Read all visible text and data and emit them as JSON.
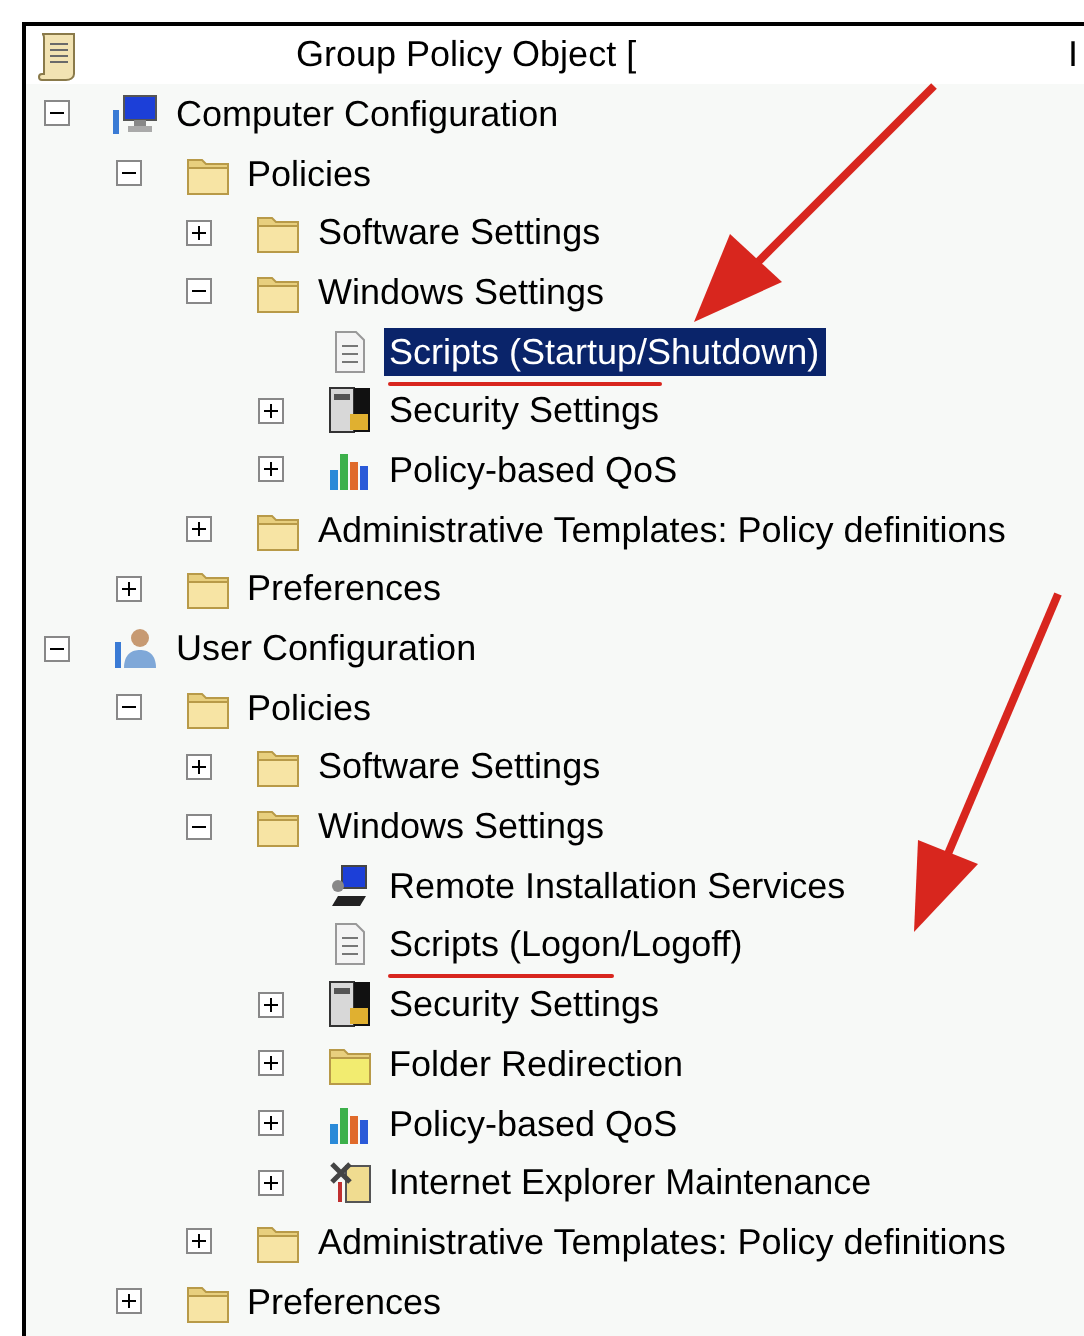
{
  "header": {
    "title": "Group Policy Object [",
    "column_2": "I"
  },
  "tree": [
    {
      "label": "Computer Configuration",
      "kind": "computer",
      "expanded": true,
      "selected": false,
      "children": [
        {
          "label": "Policies",
          "kind": "folder",
          "expanded": true,
          "selected": false,
          "children": [
            {
              "label": "Software Settings",
              "kind": "folder",
              "expanded": false,
              "selected": false
            },
            {
              "label": "Windows Settings",
              "kind": "folder",
              "expanded": true,
              "selected": false,
              "children": [
                {
                  "label": "Scripts (Startup/Shutdown)",
                  "kind": "script",
                  "selected": true,
                  "underlined": true
                },
                {
                  "label": "Security Settings",
                  "kind": "security",
                  "expanded": false,
                  "selected": false
                },
                {
                  "label": "Policy-based QoS",
                  "kind": "qos",
                  "expanded": false,
                  "selected": false
                }
              ]
            },
            {
              "label": "Administrative Templates: Policy definitions",
              "kind": "folder",
              "expanded": false,
              "selected": false
            }
          ]
        },
        {
          "label": "Preferences",
          "kind": "folder",
          "expanded": false,
          "selected": false
        }
      ]
    },
    {
      "label": "User Configuration",
      "kind": "user",
      "expanded": true,
      "selected": false,
      "children": [
        {
          "label": "Policies",
          "kind": "folder",
          "expanded": true,
          "selected": false,
          "children": [
            {
              "label": "Software Settings",
              "kind": "folder",
              "expanded": false,
              "selected": false
            },
            {
              "label": "Windows Settings",
              "kind": "folder",
              "expanded": true,
              "selected": false,
              "children": [
                {
                  "label": "Remote Installation Services",
                  "kind": "remote",
                  "selected": false
                },
                {
                  "label": "Scripts (Logon/Logoff)",
                  "kind": "script",
                  "selected": false,
                  "underlined": true
                },
                {
                  "label": "Security Settings",
                  "kind": "security",
                  "expanded": false,
                  "selected": false
                },
                {
                  "label": "Folder Redirection",
                  "kind": "redirect",
                  "expanded": false,
                  "selected": false
                },
                {
                  "label": "Policy-based QoS",
                  "kind": "qos",
                  "expanded": false,
                  "selected": false
                },
                {
                  "label": "Internet Explorer Maintenance",
                  "kind": "tools",
                  "expanded": false,
                  "selected": false
                }
              ]
            },
            {
              "label": "Administrative Templates: Policy definitions",
              "kind": "folder",
              "expanded": false,
              "selected": false
            }
          ]
        },
        {
          "label": "Preferences",
          "kind": "folder",
          "expanded": false,
          "selected": false
        }
      ]
    }
  ]
}
